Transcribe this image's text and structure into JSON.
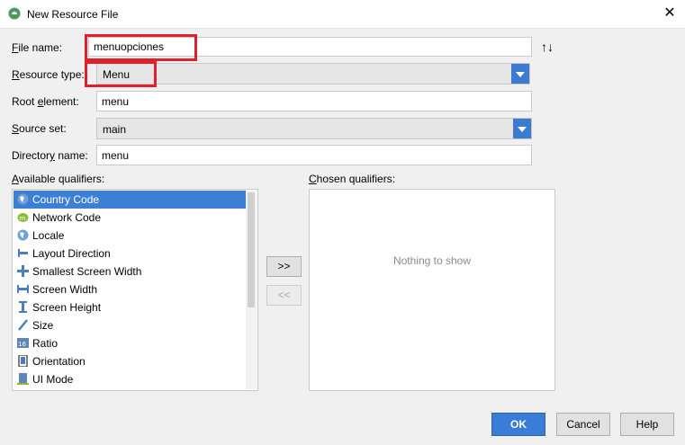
{
  "window": {
    "title": "New Resource File",
    "close_glyph": "✕"
  },
  "form": {
    "file_name": {
      "label": "File name:",
      "value": "menuopciones",
      "accel": "F"
    },
    "resource_type": {
      "label": "Resource type:",
      "value": "Menu",
      "accel": "R"
    },
    "root_element": {
      "label": "Root element:",
      "value": "menu",
      "accel": "e"
    },
    "source_set": {
      "label": "Source set:",
      "value": "main",
      "accel": "S"
    },
    "directory_name": {
      "label": "Directory name:",
      "value": "menu",
      "accel": "y"
    }
  },
  "qualifiers": {
    "available_label": "Available qualifiers:",
    "chosen_label": "Chosen qualifiers:",
    "available": [
      {
        "label": "Country Code",
        "icon": "globe-icon",
        "selected": true
      },
      {
        "label": "Network Code",
        "icon": "network-icon",
        "selected": false
      },
      {
        "label": "Locale",
        "icon": "globe-icon",
        "selected": false
      },
      {
        "label": "Layout Direction",
        "icon": "layout-direction-icon",
        "selected": false
      },
      {
        "label": "Smallest Screen Width",
        "icon": "smallest-width-icon",
        "selected": false
      },
      {
        "label": "Screen Width",
        "icon": "screen-width-icon",
        "selected": false
      },
      {
        "label": "Screen Height",
        "icon": "screen-height-icon",
        "selected": false
      },
      {
        "label": "Size",
        "icon": "size-icon",
        "selected": false
      },
      {
        "label": "Ratio",
        "icon": "ratio-icon",
        "selected": false
      },
      {
        "label": "Orientation",
        "icon": "orientation-icon",
        "selected": false
      },
      {
        "label": "UI Mode",
        "icon": "ui-mode-icon",
        "selected": false
      }
    ],
    "empty_text": "Nothing to show",
    "add_button": ">>",
    "remove_button": "<<"
  },
  "buttons": {
    "ok": "OK",
    "cancel": "Cancel",
    "help": "Help"
  },
  "colors": {
    "accent": "#3b7bd0",
    "selection": "#3d7fd6",
    "highlight_box": "#e0202a"
  }
}
